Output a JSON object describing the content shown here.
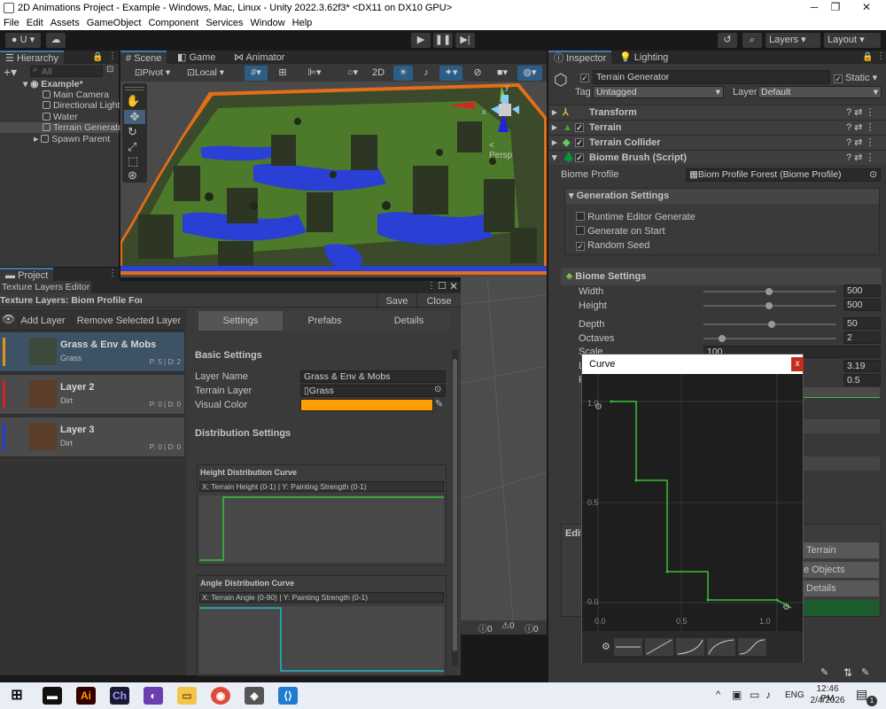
{
  "window": {
    "title": "2D Animations Project - Example - Windows, Mac, Linux - Unity 2022.3.62f3* <DX11 on DX10 GPU>",
    "minimize": "─",
    "maximize": "❐",
    "close": "✕"
  },
  "menu": [
    "File",
    "Edit",
    "Assets",
    "GameObject",
    "Component",
    "Services",
    "Window",
    "Help"
  ],
  "toolbar": {
    "account": "U",
    "layers": "Layers",
    "layout": "Layout"
  },
  "hierarchy": {
    "tab": "Hierarchy",
    "search_placeholder": "All",
    "scene": "Example*",
    "items": [
      "Main Camera",
      "Directional Light",
      "Water",
      "Terrain Generator",
      "Spawn Parent"
    ]
  },
  "scene_tabs": {
    "scene": "Scene",
    "game": "Game",
    "animator": "Animator"
  },
  "scene_toolbar": {
    "pivot": "Pivot",
    "local": "Local",
    "mode2d": "2D"
  },
  "scene_gizmo": {
    "persp": "< Persp",
    "x": "x",
    "y": "y"
  },
  "project": {
    "tab": "Project"
  },
  "texture_editor": {
    "tab": "Texture Layers Editor",
    "heading": "Texture Layers: Biom Profile Forest",
    "save": "Save",
    "close": "Close",
    "add_layer": "Add Layer",
    "remove_layer": "Remove Selected Layer",
    "tabs": [
      "Settings",
      "Prefabs",
      "Details"
    ],
    "layers": [
      {
        "name": "Grass & Env & Mobs",
        "texture": "Grass",
        "pd": "P: 5 | D: 2",
        "color": "#e0961e",
        "thumb": "#3c4a3b"
      },
      {
        "name": "Layer 2",
        "texture": "Dirt",
        "pd": "P: 0 | D: 0",
        "color": "#d22222",
        "thumb": "#5a3e2a"
      },
      {
        "name": "Layer 3",
        "texture": "Dirt",
        "pd": "P: 0 | D: 0",
        "color": "#2240d8",
        "thumb": "#5a3e2a"
      }
    ],
    "basic_settings": "Basic Settings",
    "layer_name_label": "Layer Name",
    "layer_name_value": "Grass & Env & Mobs",
    "terrain_layer_label": "Terrain Layer",
    "terrain_layer_value": "Grass",
    "visual_color_label": "Visual Color",
    "visual_color": "#ff9f00",
    "distribution_settings": "Distribution Settings",
    "height_curve_title": "Height Distribution Curve",
    "height_curve_axes": "X: Terrain Height (0-1) | Y: Painting Strength (0-1)",
    "angle_curve_title": "Angle Distribution Curve",
    "angle_curve_axes": "X: Terrain Angle (0-90) | Y: Painting Strength (0-1)"
  },
  "inspector": {
    "tab": "Inspector",
    "lighting_tab": "Lighting",
    "object_name": "Terrain Generator",
    "static": "Static",
    "tag_label": "Tag",
    "tag_value": "Untagged",
    "layer_label": "Layer",
    "layer_value": "Default",
    "components": [
      "Transform",
      "Terrain",
      "Terrain Collider",
      "Biome Brush (Script)"
    ],
    "biome_profile_label": "Biome Profile",
    "biome_profile_value": "Biom Profile Forest (Biome Profile)",
    "generation_settings": "Generation Settings",
    "gen_options": [
      {
        "label": "Runtime Editor Generate",
        "checked": false
      },
      {
        "label": "Generate on Start",
        "checked": false
      },
      {
        "label": "Random Seed",
        "checked": true
      }
    ],
    "biome_settings": "Biome Settings",
    "params": [
      {
        "label": "Width",
        "value": "500",
        "level": 0.5
      },
      {
        "label": "Height",
        "value": "500",
        "level": 0.5
      },
      {
        "label": "Depth",
        "value": "50",
        "level": 0.52
      },
      {
        "label": "Octaves",
        "value": "2",
        "level": 0.14
      },
      {
        "label": "Scale",
        "value": "100",
        "level": 0.0
      },
      {
        "label": "L",
        "value": "3.19",
        "level": 0.0
      },
      {
        "label": "P",
        "value": "0.5",
        "level": 0.0
      }
    ],
    "edit_fragment": "Edit",
    "btn_terrain": "Terrain",
    "btn_objects": "e Objects",
    "btn_details": "Details"
  },
  "curve_window": {
    "title": "Curve",
    "close": "x",
    "y_labels": [
      "1.0",
      "0.5",
      "0.0"
    ],
    "x_labels": [
      "0.0",
      "0.5",
      "1.0"
    ]
  },
  "counters": [
    "0",
    "0",
    "0"
  ],
  "taskbar": {
    "lang": "ENG",
    "time": "12:46 PM",
    "date": "2/4/2026",
    "notif_count": "1"
  },
  "colors": {
    "accent": "#3a79bb",
    "curve": "#36c236",
    "angle_curve": "#1fb7c7",
    "selection": "#2c5d87"
  }
}
